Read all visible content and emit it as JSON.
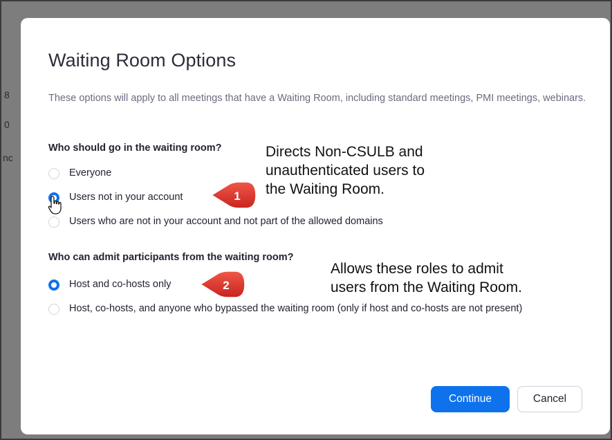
{
  "dialog": {
    "title": "Waiting Room Options",
    "description": "These options will apply to all meetings that have a Waiting Room, including standard meetings, PMI meetings, webinars."
  },
  "who_waiting": {
    "question": "Who should go in the waiting room?",
    "options": [
      {
        "label": "Everyone",
        "selected": false
      },
      {
        "label": "Users not in your account",
        "selected": true
      },
      {
        "label": "Users who are not in your account and not part of the allowed domains",
        "selected": false
      }
    ]
  },
  "who_admit": {
    "question": "Who can admit participants from the waiting room?",
    "options": [
      {
        "label": "Host and co-hosts only",
        "selected": true
      },
      {
        "label": "Host, co-hosts, and anyone who bypassed the waiting room (only if host and co-hosts are not present)",
        "selected": false
      }
    ]
  },
  "annotations": {
    "one": {
      "number": "1",
      "lines": [
        "Directs Non-CSULB and",
        "unauthenticated users to",
        "the Waiting Room."
      ]
    },
    "two": {
      "number": "2",
      "lines": [
        "Allows these roles to admit",
        "users from the Waiting Room."
      ]
    }
  },
  "buttons": {
    "continue": "Continue",
    "cancel": "Cancel"
  },
  "colors": {
    "accent": "#0e72ed",
    "marker": "#e0302a",
    "overlay": "#7d7d7d"
  },
  "icons": {
    "cursor": "hand-pointer-icon",
    "marker": "callout-arrow-icon"
  }
}
